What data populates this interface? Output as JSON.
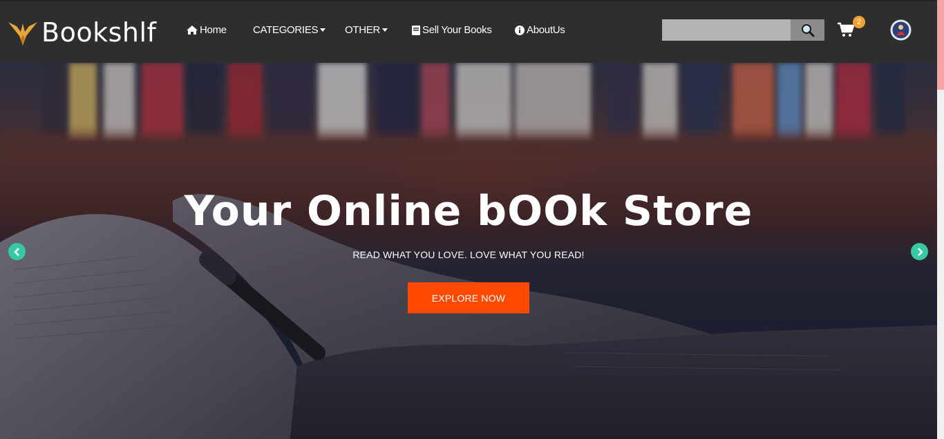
{
  "brand": {
    "name": "Bookshlf"
  },
  "nav": {
    "home": "Home",
    "categories": "CATEGORIES",
    "other": "OTHER",
    "sell": "Sell Your Books",
    "about": "AboutUs"
  },
  "search": {
    "placeholder": "",
    "value": ""
  },
  "cart": {
    "count": "2"
  },
  "hero": {
    "title": "Your Online bOOk Store",
    "subtitle": "READ WHAT YOU LOVE. LOVE WHAT YOU READ!",
    "cta": "EXPLORE NOW"
  },
  "colors": {
    "navbar": "#2e2e2e",
    "accent": "#ff4a00",
    "arrow": "#36c9a4",
    "badge": "#f0a133"
  },
  "icons": [
    "phoenix-logo-icon",
    "home-icon",
    "caret-down-icon",
    "book-icon",
    "info-icon",
    "search-icon",
    "cart-icon",
    "user-avatar-icon",
    "chevron-left-icon",
    "chevron-right-icon"
  ]
}
